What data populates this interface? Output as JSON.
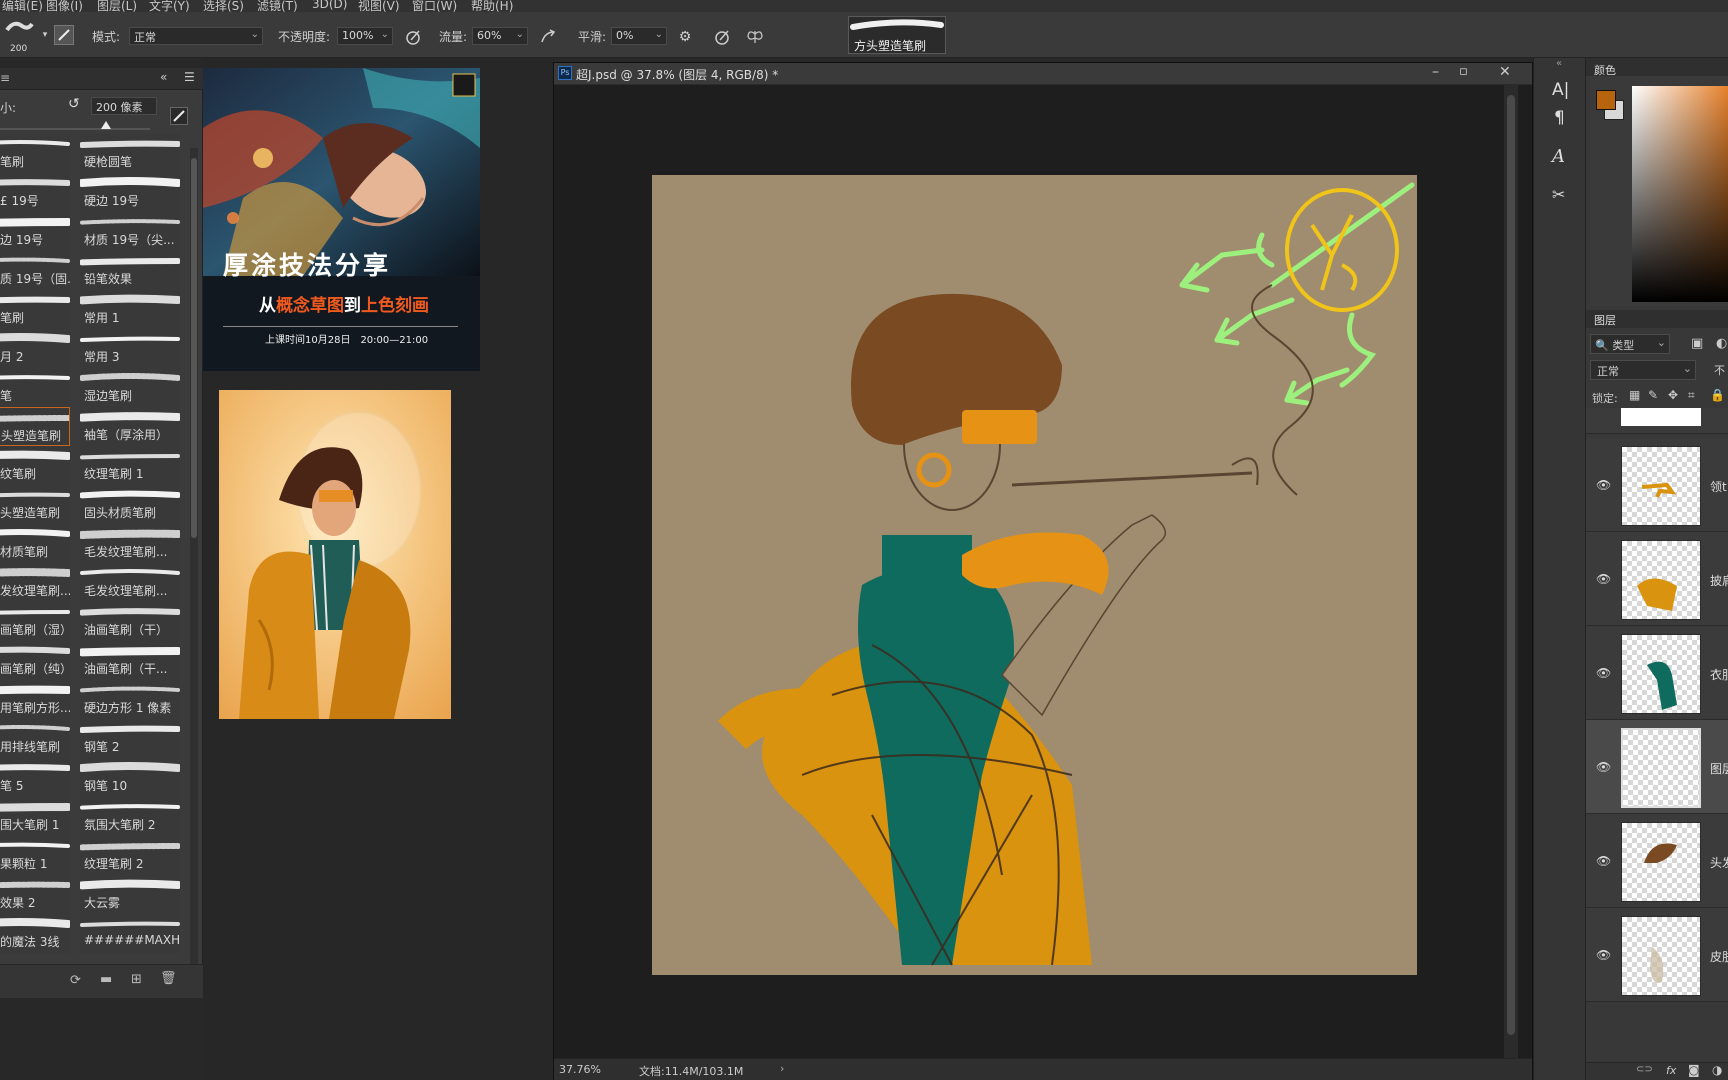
{
  "menu": [
    "编辑(E)",
    "图像(I)",
    "图层(L)",
    "文字(Y)",
    "选择(S)",
    "滤镜(T)",
    "3D(D)",
    "视图(V)",
    "窗口(W)",
    "帮助(H)"
  ],
  "options": {
    "brush_size": "200",
    "mode_label": "模式:",
    "mode_value": "正常",
    "opacity_label": "不透明度:",
    "opacity_value": "100%",
    "flow_label": "流量:",
    "flow_value": "60%",
    "smooth_label": "平滑:",
    "smooth_value": "0%",
    "preset_name": "方头塑造笔刷"
  },
  "brush_panel": {
    "size_label": "小:",
    "size_value": "200 像素",
    "brushes": [
      [
        "笔刷",
        "硬枪圆笔"
      ],
      [
        "£ 19号",
        "硬边 19号"
      ],
      [
        "边 19号",
        "材质 19号（尖..."
      ],
      [
        "质 19号（固...",
        "铅笔效果"
      ],
      [
        "笔刷",
        "常用 1"
      ],
      [
        "月 2",
        "常用 3"
      ],
      [
        "笔",
        "湿边笔刷"
      ],
      [
        "头塑造笔刷",
        "袖笔（厚涂用）"
      ],
      [
        "纹笔刷",
        "纹理笔刷 1"
      ],
      [
        "头塑造笔刷",
        "固头材质笔刷"
      ],
      [
        "材质笔刷",
        "毛发纹理笔刷..."
      ],
      [
        "发纹理笔刷...",
        "毛发纹理笔刷..."
      ],
      [
        "画笔刷（湿）",
        "油画笔刷（干）"
      ],
      [
        "画笔刷（纯）",
        "油画笔刷（干..."
      ],
      [
        "用笔刷方形...",
        "硬边方形 1 像素"
      ],
      [
        "用排线笔刷",
        "钢笔 2"
      ],
      [
        "笔 5",
        "钢笔 10"
      ],
      [
        "围大笔刷 1",
        "氛围大笔刷 2"
      ],
      [
        "果颗粒 1",
        "纹理笔刷 2"
      ],
      [
        "效果 2",
        "大云雾"
      ],
      [
        "的魔法 3线",
        "######MAXH..."
      ]
    ]
  },
  "reference": {
    "poster_title": "厚涂技法分享",
    "poster_subtitle_1": "从",
    "poster_subtitle_2": "概念草图",
    "poster_subtitle_3": "到",
    "poster_subtitle_4": "上色刻画",
    "poster_date": "上课时间10月28日　20:00—21:00"
  },
  "document": {
    "title": "超J.psd @ 37.8% (图层 4, RGB/8) *",
    "zoom": "37.76%",
    "doc_size": "文档:11.4M/103.1M"
  },
  "right_panel": {
    "color_tab": "颜色",
    "layers_tab": "图层",
    "filter_label": "类型",
    "blend_mode": "正常",
    "opacity_prefix": "不",
    "lock_label": "锁定:",
    "layers": [
      {
        "name": "领t",
        "selected": false
      },
      {
        "name": "披肩",
        "selected": false
      },
      {
        "name": "衣服",
        "selected": false
      },
      {
        "name": "图层",
        "selected": true
      },
      {
        "name": "头发",
        "selected": false
      },
      {
        "name": "皮肤",
        "selected": false
      }
    ]
  },
  "colors": {
    "foreground": "#b8630e",
    "canvas_bg": "#a08c6e",
    "accent_orange": "#e69215",
    "teal": "#0f6b5e"
  }
}
